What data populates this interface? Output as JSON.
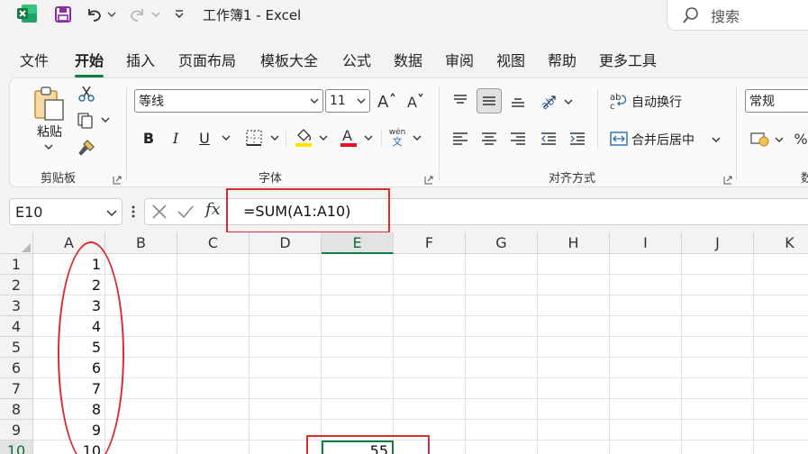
{
  "titlebar": {
    "doc_title": "工作簿1  -  Excel",
    "search_placeholder": "搜索"
  },
  "menu_tabs": [
    {
      "label": "文件",
      "active": false
    },
    {
      "label": "开始",
      "active": true
    },
    {
      "label": "插入",
      "active": false
    },
    {
      "label": "页面布局",
      "active": false
    },
    {
      "label": "模板大全",
      "active": false
    },
    {
      "label": "公式",
      "active": false
    },
    {
      "label": "数据",
      "active": false
    },
    {
      "label": "审阅",
      "active": false
    },
    {
      "label": "视图",
      "active": false
    },
    {
      "label": "帮助",
      "active": false
    },
    {
      "label": "更多工具",
      "active": false
    }
  ],
  "ribbon": {
    "clipboard": {
      "paste_label": "粘贴",
      "group_label": "剪贴板"
    },
    "font": {
      "font_name": "等线",
      "font_size": "11",
      "bold": "B",
      "italic": "I",
      "underline": "U",
      "phonetic_top": "wén",
      "phonetic_bottom": "文",
      "group_label": "字体"
    },
    "alignment": {
      "wrap_text": "自动换行",
      "merge_center": "合并后居中",
      "group_label": "对齐方式"
    },
    "number": {
      "format": "常规",
      "group_label_partial": "数"
    }
  },
  "formula_bar": {
    "name_box": "E10",
    "fx_label": "fx",
    "formula": "=SUM(A1:A10)"
  },
  "sheet": {
    "columns": [
      "A",
      "B",
      "C",
      "D",
      "E",
      "F",
      "G",
      "H",
      "I",
      "J",
      "K"
    ],
    "rows": [
      "1",
      "2",
      "3",
      "4",
      "5",
      "6",
      "7",
      "8",
      "9",
      "10"
    ],
    "selected_column": "E",
    "selected_row": "10",
    "column_a_values": [
      "1",
      "2",
      "3",
      "4",
      "5",
      "6",
      "7",
      "8",
      "9",
      "10"
    ],
    "e10_value": "55"
  },
  "colors": {
    "accent": "#107c41",
    "annotation": "#d92c2c"
  }
}
